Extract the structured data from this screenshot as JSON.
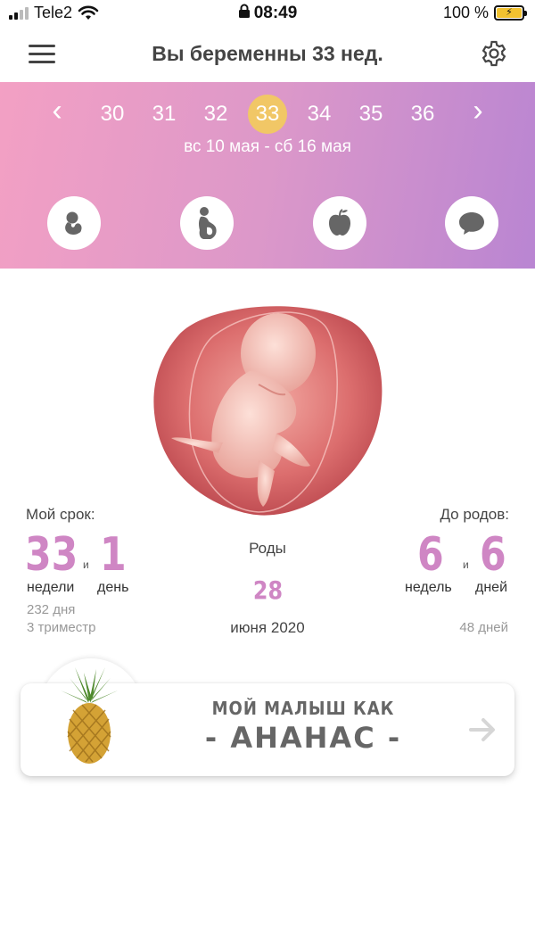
{
  "status_bar": {
    "carrier": "Tele2",
    "time": "08:49",
    "battery_text": "100 %"
  },
  "header": {
    "title": "Вы беременны 33 нед."
  },
  "week_nav": {
    "weeks": [
      "30",
      "31",
      "32",
      "33",
      "34",
      "35",
      "36"
    ],
    "selected": "33",
    "date_range": "вс 10 мая - сб 16 мая"
  },
  "features": [
    {
      "icon": "fetus-icon"
    },
    {
      "icon": "pregnant-woman-icon"
    },
    {
      "icon": "apple-icon"
    },
    {
      "icon": "chat-bubble-icon"
    }
  ],
  "stats": {
    "my_term_label": "Мой срок:",
    "weeks_value": "33",
    "and_1": "и",
    "days_value": "1",
    "weeks_unit": "недели",
    "days_unit": "день",
    "total_days": "232 дня",
    "trimester": "3 триместр",
    "due_label": "Роды",
    "due_day": "28",
    "due_month_year": "июня 2020",
    "to_birth_label": "До родов:",
    "left_weeks": "6",
    "and_2": "и",
    "left_days": "6",
    "left_weeks_unit": "недель",
    "left_days_unit": "дней",
    "left_total_days": "48 дней"
  },
  "fruit_card": {
    "line1": "МОЙ МАЛЫШ КАК",
    "line2": "- АНАНАС -",
    "icon": "pineapple-icon"
  },
  "colors": {
    "accent": "#cf86c4",
    "band_start": "#f3a0c4",
    "band_end": "#b985d2",
    "selected_week": "#f1c766"
  }
}
